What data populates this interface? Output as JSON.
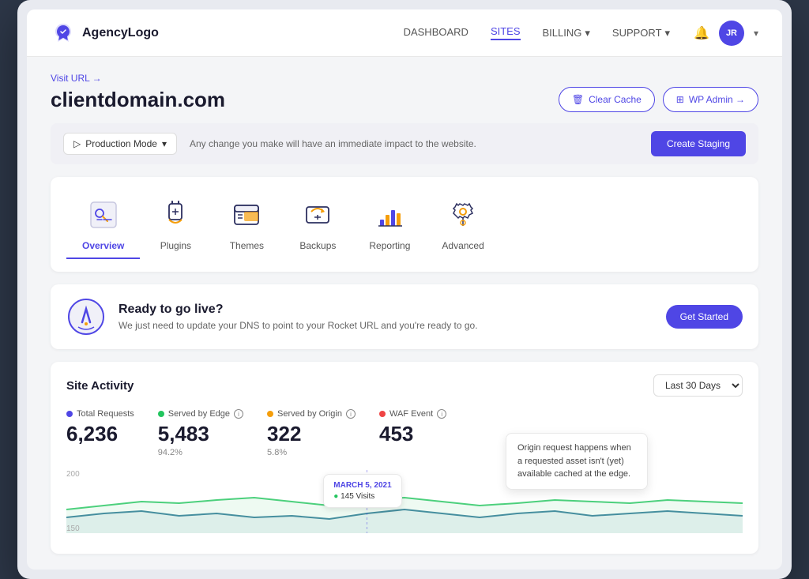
{
  "header": {
    "logo_text": "AgencyLogo",
    "nav": {
      "dashboard": "DASHBOARD",
      "sites": "SITES",
      "billing": "BILLING",
      "support": "SUPPORT"
    },
    "avatar_initials": "JR"
  },
  "breadcrumb": {
    "visit_url": "Visit URL →"
  },
  "site": {
    "domain": "clientdomain.com",
    "clear_cache_label": "Clear Cache",
    "wp_admin_label": "WP Admin →",
    "mode_label": "Production Mode",
    "mode_notice": "Any change you make will have an immediate impact to the website.",
    "create_staging_label": "Create Staging"
  },
  "tabs": [
    {
      "id": "overview",
      "label": "Overview",
      "active": true
    },
    {
      "id": "plugins",
      "label": "Plugins",
      "active": false
    },
    {
      "id": "themes",
      "label": "Themes",
      "active": false
    },
    {
      "id": "backups",
      "label": "Backups",
      "active": false
    },
    {
      "id": "reporting",
      "label": "Reporting",
      "active": false
    },
    {
      "id": "advanced",
      "label": "Advanced",
      "active": false
    }
  ],
  "ready_banner": {
    "title": "Ready to go live?",
    "description": "We just need to update your DNS to point to your Rocket URL and you're ready to go.",
    "button_label": "Get Started"
  },
  "activity": {
    "title": "Site Activity",
    "period_label": "Last 30 Days",
    "stats": [
      {
        "label": "Total Requests",
        "dot_color": "#4f46e5",
        "value": "6,236",
        "sub": ""
      },
      {
        "label": "Served by Edge",
        "dot_color": "#22c55e",
        "value": "5,483",
        "sub": "94.2%"
      },
      {
        "label": "Served by Origin",
        "dot_color": "#f59e0b",
        "value": "322",
        "sub": "5.8%"
      },
      {
        "label": "WAF Event",
        "dot_color": "#ef4444",
        "value": "453",
        "sub": ""
      }
    ],
    "tooltip_text": "Origin request happens when a requested asset isn't (yet) available cached at the edge.",
    "chart_tooltip": {
      "date": "MARCH 5, 2021",
      "visits": "145 Visits"
    },
    "y_labels": [
      "200",
      "150"
    ]
  }
}
